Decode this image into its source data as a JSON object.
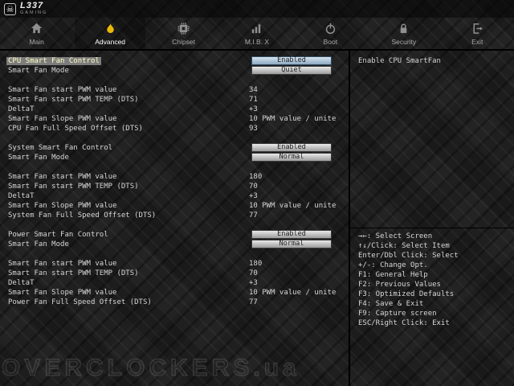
{
  "logo": {
    "title": "L337",
    "subtitle": "GAMING"
  },
  "tabs": [
    {
      "label": "Main"
    },
    {
      "label": "Advanced",
      "active": true
    },
    {
      "label": "Chipset"
    },
    {
      "label": "M.I.B. X"
    },
    {
      "label": "Boot"
    },
    {
      "label": "Security"
    },
    {
      "label": "Exit"
    }
  ],
  "settings": {
    "rows": [
      {
        "label": "CPU Smart Fan Control",
        "value": "Enabled",
        "control": "button",
        "selected": true,
        "highlight": true
      },
      {
        "label": "Smart Fan Mode",
        "value": "Quiet",
        "control": "button"
      },
      {
        "blank": true
      },
      {
        "label": "Smart Fan start PWM value",
        "value": "34"
      },
      {
        "label": "Smart Fan start PWM TEMP (DTS)",
        "value": "71"
      },
      {
        "label": "DeltaT",
        "value": "+3"
      },
      {
        "label": "Smart Fan Slope PWM value",
        "value": "10 PWM value / unite"
      },
      {
        "label": "CPU Fan Full Speed Offset (DTS)",
        "value": "93"
      },
      {
        "blank": true
      },
      {
        "label": "System Smart Fan Control",
        "value": "Enabled",
        "control": "button"
      },
      {
        "label": "Smart Fan Mode",
        "value": "Normal",
        "control": "button"
      },
      {
        "blank": true
      },
      {
        "label": "Smart Fan start PWM value",
        "value": "180"
      },
      {
        "label": "Smart Fan start PWM TEMP (DTS)",
        "value": "70"
      },
      {
        "label": "DeltaT",
        "value": "+3"
      },
      {
        "label": "Smart Fan Slope PWM value",
        "value": "10 PWM value / unite"
      },
      {
        "label": "System Fan Full Speed Offset (DTS)",
        "value": "77"
      },
      {
        "blank": true
      },
      {
        "label": "Power Smart Fan Control",
        "value": "Enabled",
        "control": "button"
      },
      {
        "label": "Smart Fan Mode",
        "value": "Normal",
        "control": "button"
      },
      {
        "blank": true
      },
      {
        "label": "Smart Fan start PWM value",
        "value": "180"
      },
      {
        "label": "Smart Fan start PWM TEMP (DTS)",
        "value": "70"
      },
      {
        "label": "DeltaT",
        "value": "+3"
      },
      {
        "label": "Smart Fan Slope PWM value",
        "value": "10 PWM value / unite"
      },
      {
        "label": "Power Fan Full Speed Offset (DTS)",
        "value": "77"
      }
    ]
  },
  "help": {
    "text": "Enable CPU SmartFan"
  },
  "legend": {
    "lines": [
      "→←: Select Screen",
      "↑↓/Click: Select Item",
      "Enter/Dbl Click: Select",
      "+/-: Change Opt.",
      "F1: General Help",
      "F2: Previous Values",
      "F3: Optimized Defaults",
      "F4: Save & Exit",
      "F9: Capture screen",
      "ESC/Right Click: Exit"
    ]
  },
  "watermark": "OVERCLOCKERS.ua",
  "colors": {
    "accent": "#eab908",
    "selection": "#7d7d7d",
    "button_highlight": "#8da9c1"
  }
}
